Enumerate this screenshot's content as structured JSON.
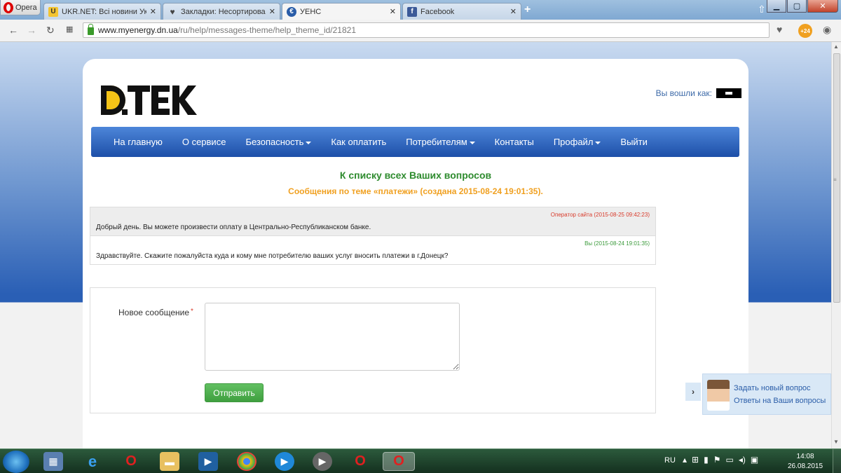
{
  "browser": {
    "opera_label": "Opera",
    "tabs": [
      {
        "title": "UKR.NET: Всі новини Украї",
        "close": "✕",
        "favicon": "ukrnet-icon",
        "fav_color": "#f3c431"
      },
      {
        "title": "Закладки: Несортировани",
        "close": "✕",
        "favicon": "heart-icon",
        "fav_color": "#444444"
      },
      {
        "title": "УЕНС",
        "close": "✕",
        "favicon": "uens-icon",
        "fav_color": "#2a5da8"
      },
      {
        "title": "Facebook",
        "close": "✕",
        "favicon": "facebook-icon",
        "fav_color": "#3b5998"
      }
    ],
    "new_tab": "+",
    "url_host": "www.myenergy.dn.ua",
    "url_path": "/ru/help/messages-theme/help_theme_id/21821",
    "badge": "+24"
  },
  "page": {
    "logged_in_label": "Вы вошли как:",
    "menu": [
      {
        "label": "На главную",
        "dropdown": false
      },
      {
        "label": "О сервисе",
        "dropdown": false
      },
      {
        "label": "Безопасность",
        "dropdown": true
      },
      {
        "label": "Как оплатить",
        "dropdown": false
      },
      {
        "label": "Потребителям",
        "dropdown": true
      },
      {
        "label": "Контакты",
        "dropdown": false
      },
      {
        "label": "Профайл",
        "dropdown": true
      },
      {
        "label": "Выйти",
        "dropdown": false
      }
    ],
    "back_link": "К списку всех Ваших вопросов",
    "theme_line": "Сообщения по теме «платежи» (создана 2015-08-24 19:01:35).",
    "messages": [
      {
        "author_meta": "Оператор сайта (2015-08-25 09:42:23)",
        "text": "Добрый день. Вы можете произвести оплату в Центрально-Республиканском банке.",
        "from": "op"
      },
      {
        "author_meta": "Вы (2015-08-24 19:01:35)",
        "text": "Здравствуйте. Скажите пожалуйста куда и кому мне потребителю ваших услуг вносить платежи в г.Донецк?",
        "from": "me"
      }
    ],
    "form": {
      "label": "Новое сообщение",
      "required_mark": "*",
      "value": "",
      "submit_label": "Отправить"
    },
    "help": {
      "ask_new": "Задать новый вопрос",
      "answers": "Ответы на Ваши вопросы",
      "toggle": "›"
    }
  },
  "taskbar": {
    "lang": "RU",
    "time": "14:08",
    "date": "26.08.2015"
  },
  "colors": {
    "menu_top": "#4d86d9",
    "menu_bottom": "#1d4fa8",
    "back_link": "#2e8b2e",
    "theme_line": "#f0a020",
    "send_button": "#4caf50"
  }
}
